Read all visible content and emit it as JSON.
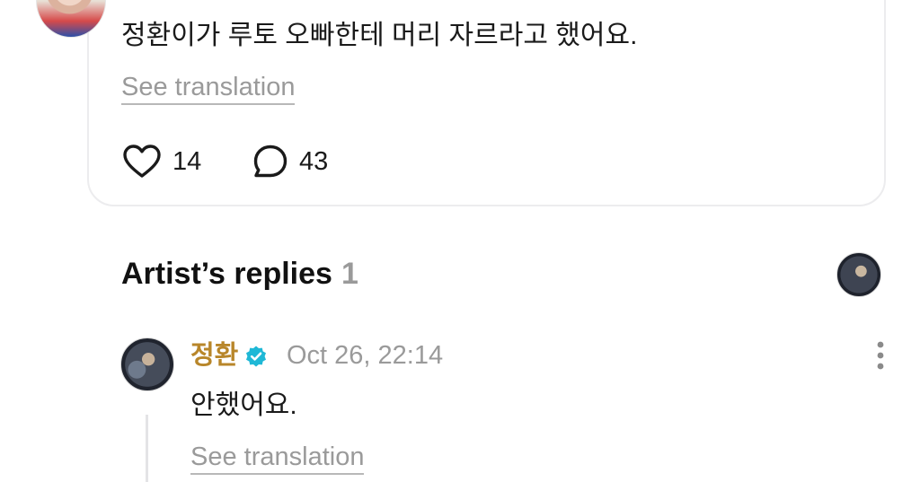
{
  "post": {
    "text": "정환이가 루토 오빠한테 머리 자르라고 했어요.",
    "see_translation": "See translation",
    "likes": "14",
    "comments": "43"
  },
  "artist_replies": {
    "title": "Artist’s replies",
    "count": "1",
    "replies": [
      {
        "author": "정환",
        "verified": true,
        "timestamp": "Oct 26, 22:14",
        "text": "안했어요.",
        "see_translation": "See translation"
      }
    ]
  },
  "icons": {
    "like": "heart-outline-icon",
    "comment": "speech-bubble-icon",
    "verified": "verified-check-icon",
    "more": "vertical-ellipsis-icon"
  },
  "colors": {
    "artist_name": "#b8862a",
    "verified_badge": "#1fb8d6",
    "muted_text": "#9a9a9a"
  }
}
